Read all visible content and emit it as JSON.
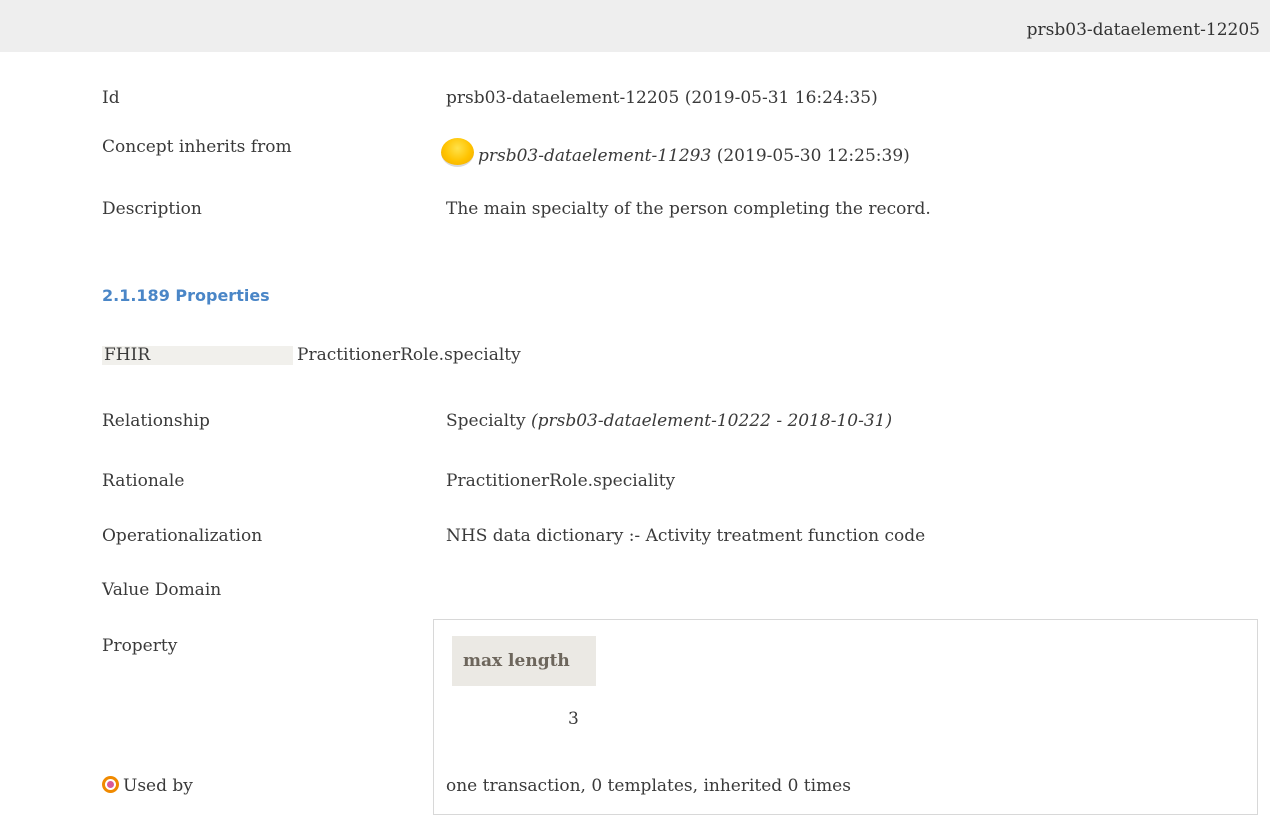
{
  "header": {
    "id": "prsb03-dataelement-12205"
  },
  "fields": {
    "id_label": "Id",
    "id_value": "prsb03-dataelement-12205 (2019-05-31 16:24:35)",
    "inherits_label": "Concept inherits from",
    "inherits_link": "prsb03-dataelement-11293",
    "inherits_date": "(2019-05-30 12:25:39)",
    "description_label": "Description",
    "description_value": "The main specialty of the person completing the record."
  },
  "properties_section": {
    "heading": "2.1.189 Properties",
    "fhir_label": "FHIR",
    "fhir_value": "PractitionerRole.specialty",
    "relationship_label": "Relationship",
    "relationship_name": "Specialty",
    "relationship_ref": "(prsb03-dataelement-10222 - 2018-10-31)",
    "rationale_label": "Rationale",
    "rationale_value": "PractitionerRole.speciality",
    "operationalization_label": "Operationalization",
    "operationalization_value": "NHS data dictionary :- Activity treatment function code",
    "value_domain_label": "Value Domain",
    "property_label": "Property",
    "property_table": {
      "header": "max length",
      "value": "3"
    },
    "used_by_label": "Used by",
    "used_by_value": "one transaction, 0 templates, inherited 0 times"
  },
  "colors": {
    "heading_blue": "#4a86c7",
    "status_dot": "#ffc300",
    "usage_icon": "#f08a00"
  },
  "icons": {
    "status": "yellow-status-dot-icon",
    "used_by": "target-icon"
  }
}
